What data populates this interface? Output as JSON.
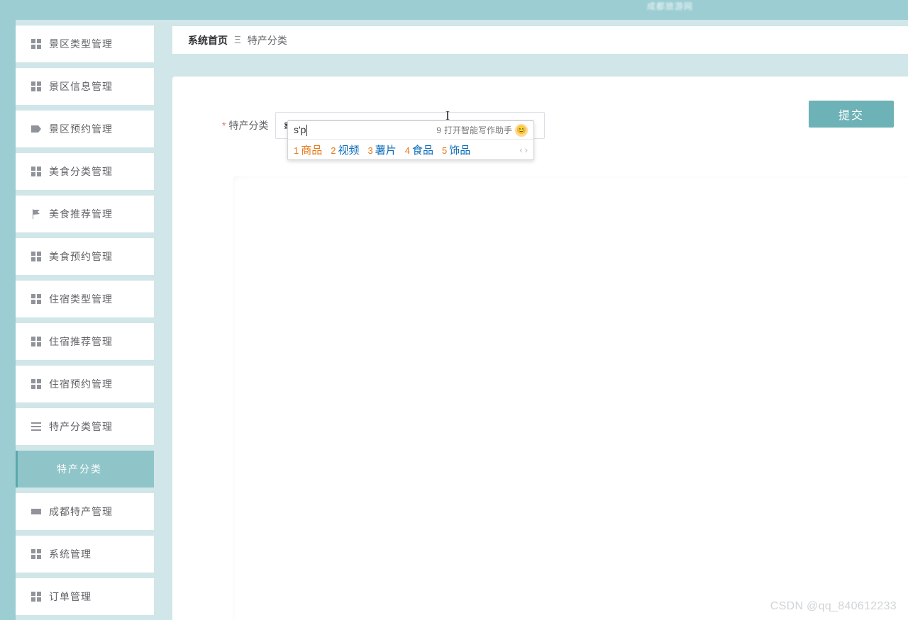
{
  "header": {
    "site_title": "成都旅游网"
  },
  "breadcrumb": {
    "home": "系统首页",
    "separator": "Ξ",
    "page": "特产分类"
  },
  "sidebar": {
    "items": [
      {
        "label": "景区类型管理",
        "icon": "grid"
      },
      {
        "label": "景区信息管理",
        "icon": "grid"
      },
      {
        "label": "景区预约管理",
        "icon": "label"
      },
      {
        "label": "美食分类管理",
        "icon": "grid"
      },
      {
        "label": "美食推荐管理",
        "icon": "flag"
      },
      {
        "label": "美食预约管理",
        "icon": "grid"
      },
      {
        "label": "住宿类型管理",
        "icon": "grid"
      },
      {
        "label": "住宿推荐管理",
        "icon": "grid"
      },
      {
        "label": "住宿预约管理",
        "icon": "grid"
      },
      {
        "label": "特产分类管理",
        "icon": "list"
      },
      {
        "label": "特产分类",
        "icon": "",
        "active": true
      },
      {
        "label": "成都特产管理",
        "icon": "ticket"
      },
      {
        "label": "系统管理",
        "icon": "grid"
      },
      {
        "label": "订单管理",
        "icon": "grid"
      }
    ]
  },
  "form": {
    "field_label": "特产分类",
    "required_marker": "*",
    "input_value": "sp",
    "submit_label": "提交"
  },
  "ime": {
    "pinyin": "s'p",
    "assist_num": "9",
    "assist_text": "打开智能写作助手",
    "candidates": [
      {
        "num": "1",
        "text": "商品"
      },
      {
        "num": "2",
        "text": "视频"
      },
      {
        "num": "3",
        "text": "薯片"
      },
      {
        "num": "4",
        "text": "食品"
      },
      {
        "num": "5",
        "text": "饰品"
      }
    ],
    "nav_prev": "‹",
    "nav_next": "›"
  },
  "watermark": "CSDN @qq_840612233"
}
